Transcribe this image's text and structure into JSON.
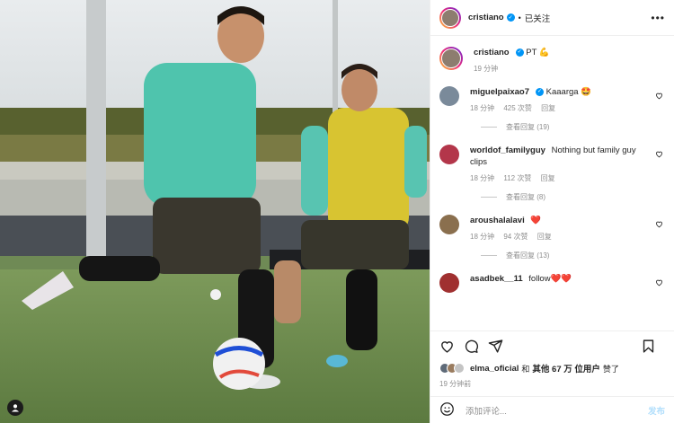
{
  "post": {
    "author": "cristiano",
    "author_verified": true,
    "separator": "•",
    "follow_state": "已关注",
    "more_icon": "more-options-icon"
  },
  "caption": {
    "author": "cristiano",
    "text": "PT",
    "emoji": "💪",
    "time": "19 分钟"
  },
  "comments": [
    {
      "user": "miguelpaixao7",
      "verified": true,
      "text": "Kaaarga",
      "emoji": "🤩",
      "time": "18 分钟",
      "likes": "425 次赞",
      "reply": "回复",
      "view_replies": "查看回复 (19)",
      "avatar_color": "#7a8a9a"
    },
    {
      "user": "worldof_familyguy",
      "verified": false,
      "text": "Nothing but family guy clips",
      "emoji": "",
      "time": "18 分钟",
      "likes": "112 次赞",
      "reply": "回复",
      "view_replies": "查看回复 (8)",
      "avatar_color": "#b3364a"
    },
    {
      "user": "aroushalalavi",
      "verified": false,
      "text": "",
      "emoji": "❤️",
      "time": "18 分钟",
      "likes": "94 次赞",
      "reply": "回复",
      "view_replies": "查看回复 (13)",
      "avatar_color": "#8a6f4e"
    },
    {
      "user": "asadbek__11",
      "verified": false,
      "text": "follow",
      "emoji": "❤️❤️",
      "time": "",
      "likes": "",
      "reply": "",
      "view_replies": "",
      "avatar_color": "#a03030"
    }
  ],
  "likes": {
    "first_liker": "elma_oficial",
    "joiner": "和",
    "others": "其他 67 万 位用户",
    "suffix": "赞了"
  },
  "timestamp": "19 分钟前",
  "add_comment": {
    "placeholder": "添加评论...",
    "post_label": "发布"
  },
  "colors": {
    "verified_blue": "#0095f6",
    "heart_red": "#ed4956",
    "muted_text": "#8e8e8e",
    "post_button_disabled": "#b2dffc"
  }
}
